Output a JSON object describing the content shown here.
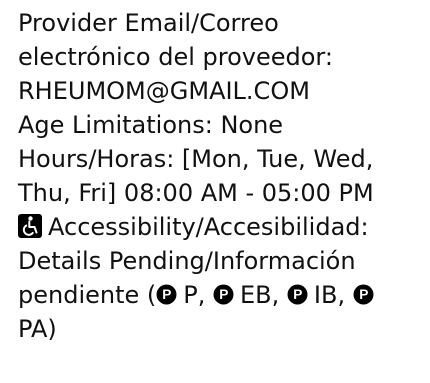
{
  "provider": {
    "email_label_line1": "Provider Email/Correo",
    "email_label_line2": "electrónico del proveedor:",
    "email_value": "RHEUMOM@GMAIL.COM"
  },
  "age": {
    "text": "Age Limitations: None"
  },
  "hours": {
    "line1": "Hours/Horas: [Mon, Tue, Wed,",
    "line2": "Thu, Fri] 08:00 AM - 05:00 PM"
  },
  "accessibility": {
    "icon": "wheelchair-accessible-icon",
    "label": "Accessibility/Accesibilidad:",
    "details_line": "Details Pending/Información",
    "pending_prefix": "pendiente (",
    "parking_icon": "parking-p-icon",
    "codes": [
      "P",
      "EB",
      "IB",
      "PA"
    ],
    "closing": ")"
  },
  "colors": {
    "text": "#111111",
    "icon": "#000000"
  }
}
